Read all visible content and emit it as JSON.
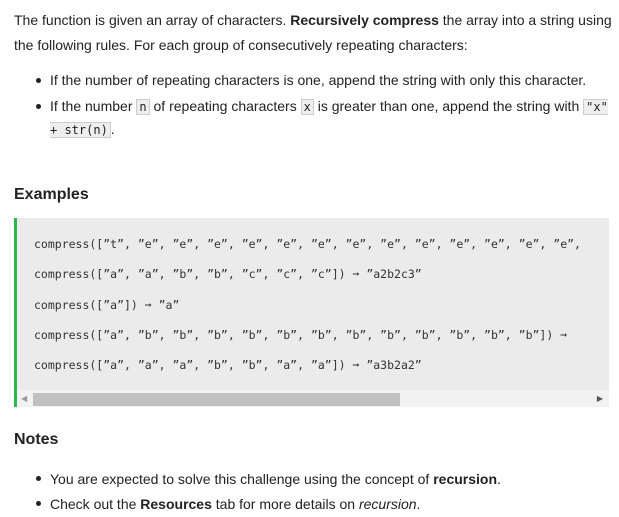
{
  "intro": {
    "a": "The function is given an array of characters. ",
    "b": "Recursively compress",
    "c": " the array into a string using the following rules. For each group of consecutively repeating characters:"
  },
  "rules": [
    {
      "text": "If the number of repeating characters is one, append the string with only this character."
    },
    {
      "a": "If the number ",
      "n": "n",
      "b": " of repeating characters ",
      "x": "x",
      "c": " is greater than one, append the string with ",
      "code": "\"x\" + str(n)",
      "d": "."
    }
  ],
  "examples_heading": "Examples",
  "examples": [
    "compress([”t”, ”e”, ”e”, ”e”, ”e”, ”e”, ”e”, ”e”, ”e”, ”e”, ”e”, ”e”, ”e”, ”e”,",
    "compress([”a”, ”a”, ”b”, ”b”, ”c”, ”c”, ”c”]) ➞ ”a2b2c3”",
    "compress([”a”]) ➞ ”a”",
    "compress([”a”, ”b”, ”b”, ”b”, ”b”, ”b”, ”b”, ”b”, ”b”, ”b”, ”b”, ”b”, ”b”]) ➞",
    "compress([”a”, ”a”, ”a”, ”b”, ”b”, ”a”, ”a”]) ➞ ”a3b2a2”"
  ],
  "notes_heading": "Notes",
  "notes": [
    {
      "a": "You are expected to solve this challenge using the concept of ",
      "b": "recursion",
      "c": "."
    },
    {
      "a": "Check out the ",
      "b": "Resources",
      "c": " tab for more details on ",
      "d": "recursion",
      "e": "."
    }
  ]
}
